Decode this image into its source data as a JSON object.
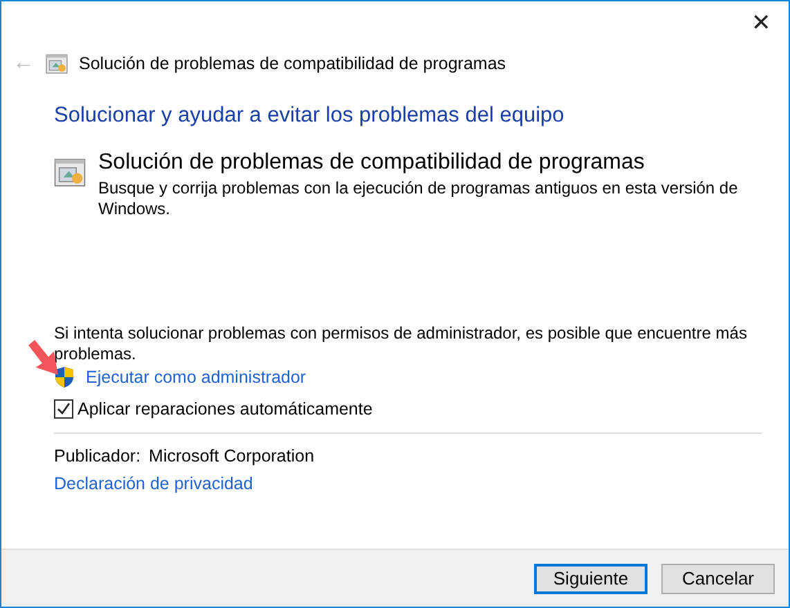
{
  "window": {
    "title": "Solución de problemas de compatibilidad de programas",
    "close": "✕",
    "back": "←"
  },
  "heading": "Solucionar y ayudar a evitar los problemas del equipo",
  "troubleshooter": {
    "title": "Solución de problemas de compatibilidad de programas",
    "description": "Busque y corrija problemas con la ejecución de programas antiguos en esta versión de Windows."
  },
  "admin_note": "Si intenta solucionar problemas con permisos de administrador, es posible que encuentre más problemas.",
  "admin_link": "Ejecutar como administrador",
  "auto_repair": {
    "label": "Aplicar reparaciones automáticamente",
    "checked": true
  },
  "publisher": {
    "label": "Publicador:",
    "value": "Microsoft Corporation"
  },
  "privacy_link": "Declaración de privacidad",
  "buttons": [
    {
      "label": "Siguiente",
      "kind": "default"
    },
    {
      "label": "Cancelar",
      "kind": "normal"
    }
  ]
}
